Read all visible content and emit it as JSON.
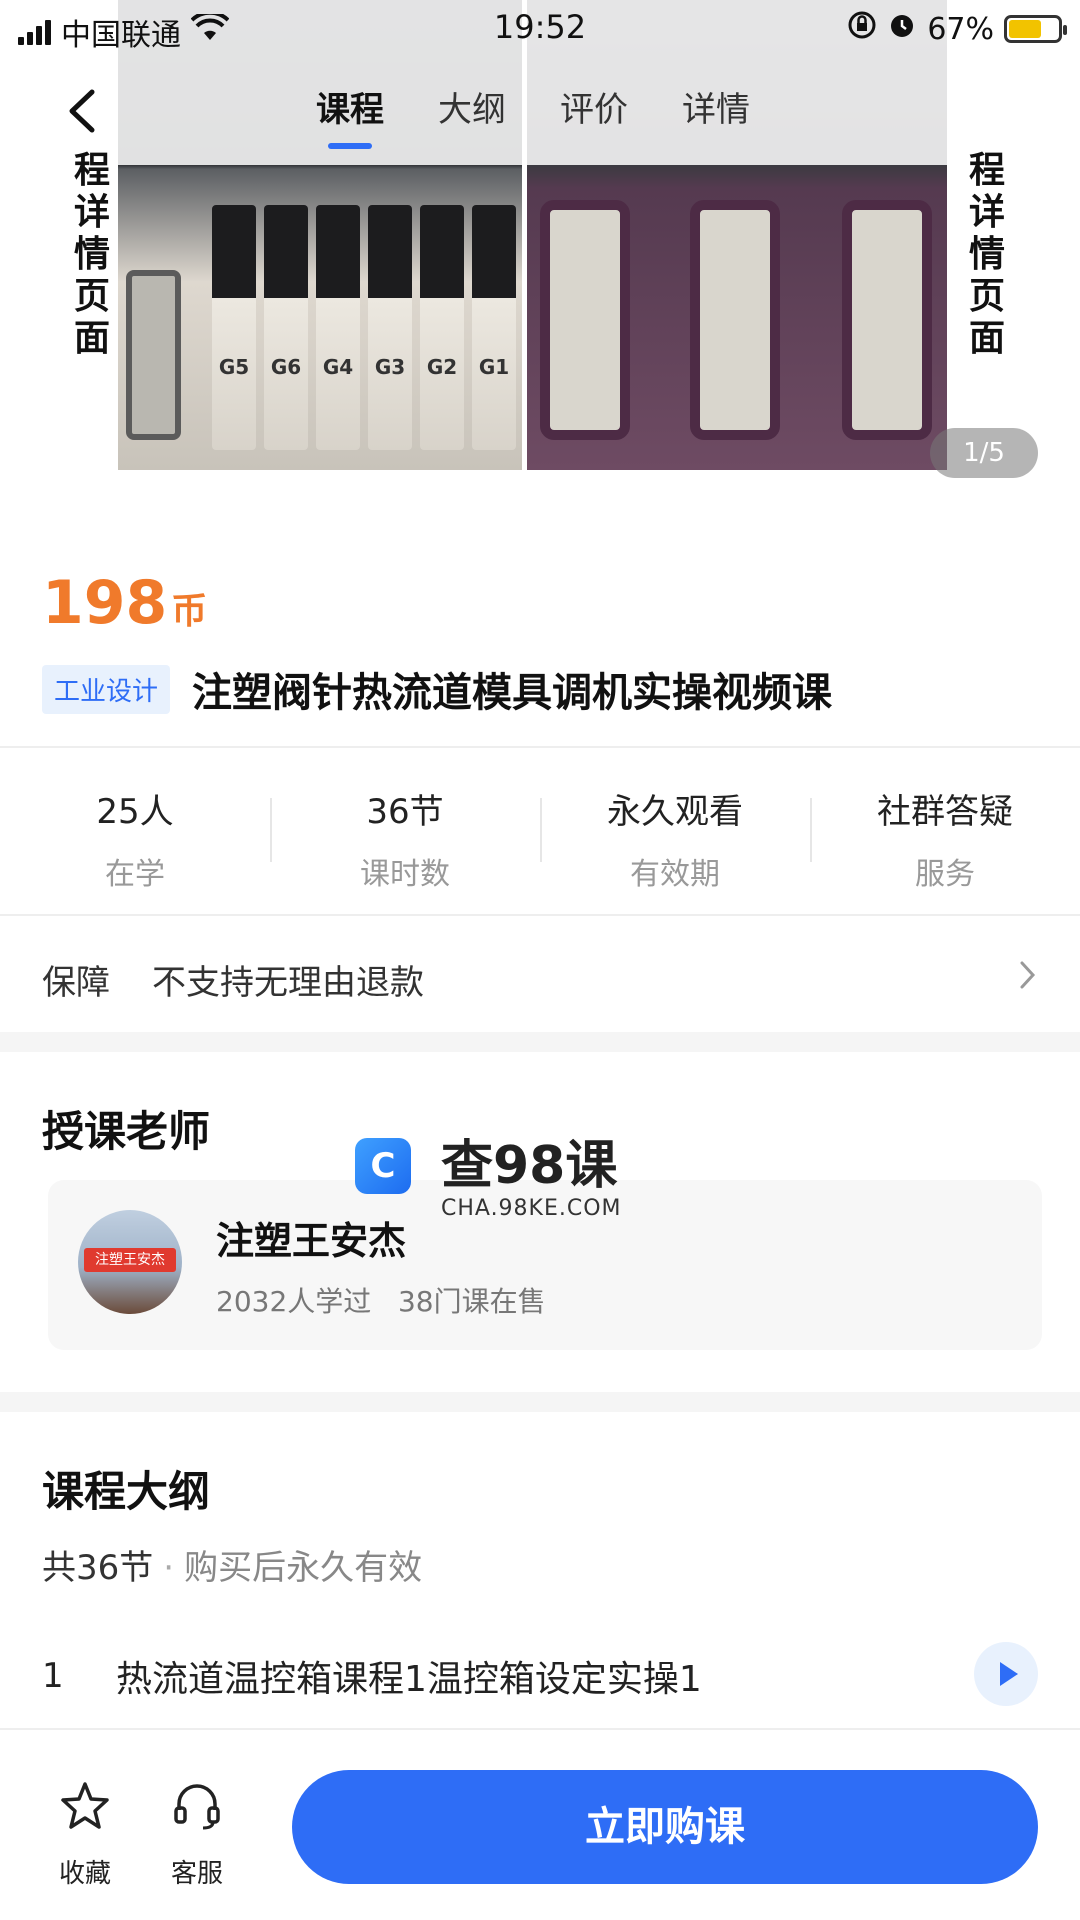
{
  "status_bar": {
    "carrier": "中国联通",
    "time": "19:52",
    "battery": "67%",
    "battery_level": 0.67
  },
  "nav": {
    "tabs": [
      {
        "label": "课程"
      },
      {
        "label": "大纲"
      },
      {
        "label": "评价"
      },
      {
        "label": "详情"
      }
    ],
    "active_tab": "课程"
  },
  "hero": {
    "overlay_left": "程详情页面",
    "overlay_right": "程详情页面",
    "valves": [
      "G5",
      "G6",
      "G4",
      "G3",
      "G2",
      "G1"
    ],
    "pager": "1/5"
  },
  "course": {
    "price": "198",
    "price_unit": "币",
    "tag": "工业设计",
    "title": "注塑阀针热流道模具调机实操视频课"
  },
  "stats": [
    {
      "value": "25人",
      "label": "在学"
    },
    {
      "value": "36节",
      "label": "课时数"
    },
    {
      "value": "永久观看",
      "label": "有效期"
    },
    {
      "value": "社群答疑",
      "label": "服务"
    }
  ],
  "guarantee": {
    "label": "保障",
    "value": "不支持无理由退款"
  },
  "teacher": {
    "section_title": "授课老师",
    "name": "注塑王安杰",
    "avatar_banner": "注塑王安杰",
    "learners": "2032人学过",
    "courses": "38门课在售"
  },
  "watermark": {
    "main": "查98课",
    "sub": "CHA.98KE.COM"
  },
  "syllabus": {
    "section_title": "课程大纲",
    "count": "共36节",
    "note": "购买后永久有效",
    "lessons": [
      {
        "num": "1",
        "title": "热流道温控箱课程1温控箱设定实操1"
      }
    ]
  },
  "bottom_bar": {
    "favorite": "收藏",
    "service": "客服",
    "buy": "立即购课"
  },
  "colors": {
    "accent": "#2e6df6",
    "price": "#f07a2b",
    "tag_bg": "#e8f1fd"
  }
}
